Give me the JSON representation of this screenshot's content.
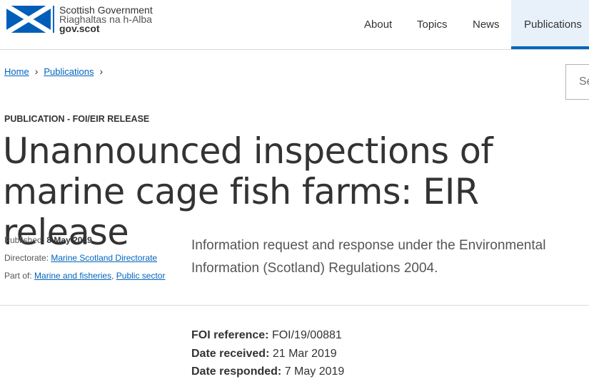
{
  "header": {
    "brand": {
      "name_en": "Scottish Government",
      "name_gd": "Riaghaltas na h-Alba",
      "domain": "gov.scot",
      "flag_icon": "saltire-flag-icon",
      "flag_color": "#005eb8"
    },
    "nav": {
      "about": "About",
      "topics": "Topics",
      "news": "News",
      "publications": "Publications"
    },
    "accent_color": "#0065bd"
  },
  "breadcrumb": {
    "home": "Home",
    "publications": "Publications",
    "separator": "›"
  },
  "search": {
    "placeholder": "Search"
  },
  "page": {
    "label": "Publication - FOI/EIR release",
    "title": "Unannounced inspections of marine cage fish farms: EIR release",
    "summary": "Information request and response under the Environmental Information (Scotland) Regulations 2004."
  },
  "meta": {
    "published_label": "Published:",
    "published_value": "8 May 2019",
    "directorate_label": "Directorate:",
    "directorate_value": "Marine Scotland Directorate",
    "part_of_label": "Part of:",
    "part_of_1": "Marine and fisheries",
    "part_of_sep": ",",
    "part_of_2": "Public sector"
  },
  "foi": {
    "reference_label": "FOI reference:",
    "reference_value": "FOI/19/00881",
    "received_label": "Date received:",
    "received_value": "21 Mar 2019",
    "responded_label": "Date responded:",
    "responded_value": "7 May 2019"
  }
}
